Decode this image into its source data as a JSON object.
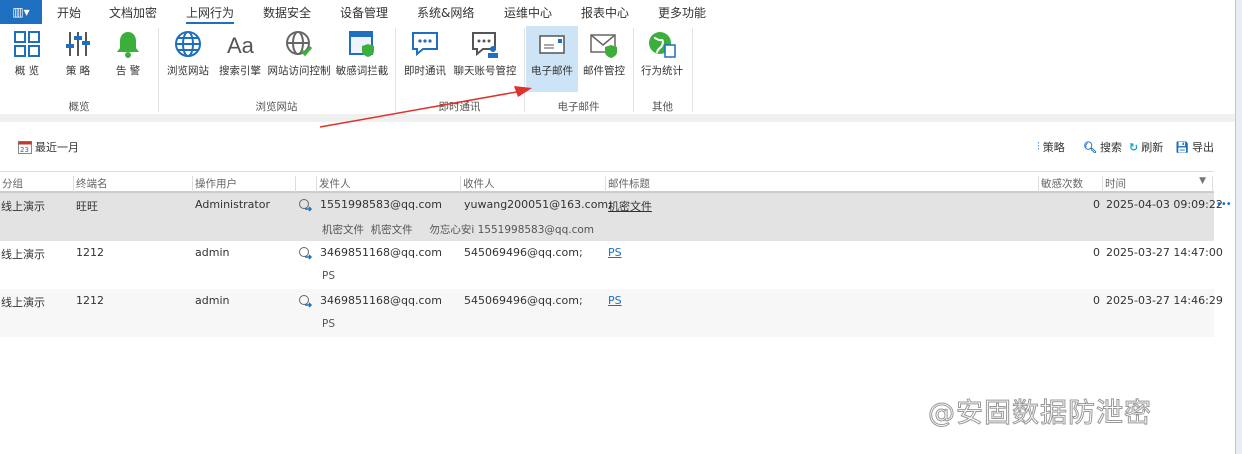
{
  "menubar": {
    "items": [
      "开始",
      "文档加密",
      "上网行为",
      "数据安全",
      "设备管理",
      "系统&网络",
      "运维中心",
      "报表中心",
      "更多功能"
    ],
    "active": "上网行为"
  },
  "ribbon": {
    "buttons": [
      {
        "label": "概 览",
        "icon": "grid-icon"
      },
      {
        "label": "策 略",
        "icon": "sliders-icon"
      },
      {
        "label": "告 警",
        "icon": "bell-icon"
      },
      {
        "label": "浏览网站",
        "icon": "globe-icon"
      },
      {
        "label": "搜索引擎",
        "icon": "font-aa-icon"
      },
      {
        "label": "网站访问控制",
        "icon": "globe-check-icon"
      },
      {
        "label": "敏感词拦截",
        "icon": "webpage-shield-icon"
      },
      {
        "label": "即时通讯",
        "icon": "chat-icon"
      },
      {
        "label": "聊天账号管控",
        "icon": "chat-user-icon"
      },
      {
        "label": "电子邮件",
        "icon": "envelope-icon"
      },
      {
        "label": "邮件管控",
        "icon": "envelope-shield-icon"
      },
      {
        "label": "行为统计",
        "icon": "globe-chart-icon"
      }
    ],
    "groups": [
      "概览",
      "浏览网站",
      "即时通讯",
      "电子邮件",
      "其他"
    ],
    "selected": "电子邮件"
  },
  "toolbar": {
    "date_range": "最近一月",
    "policy": "策略",
    "search": "搜索",
    "refresh": "刷新",
    "export": "导出"
  },
  "table": {
    "headers": [
      "分组",
      "终端名",
      "操作用户",
      "发件人",
      "收件人",
      "邮件标题",
      "敏感次数",
      "时间"
    ],
    "rows": [
      {
        "group": "线上演示",
        "terminal": "旺旺",
        "user": "Administrator",
        "sender": "1551998583@qq.com",
        "receiver": "yuwang200051@163.com;",
        "subject": "机密文件",
        "count": "0",
        "time": "2025-04-03 09:09:22",
        "detail": "机密文件  机密文件     勿忘心安i 1551998583@qq.com",
        "selected": true
      },
      {
        "group": "线上演示",
        "terminal": "1212",
        "user": "admin",
        "sender": "3469851168@qq.com",
        "receiver": "545069496@qq.com;",
        "subject": "PS",
        "count": "0",
        "time": "2025-03-27 14:47:00",
        "detail": "PS"
      },
      {
        "group": "线上演示",
        "terminal": "1212",
        "user": "admin",
        "sender": "3469851168@qq.com",
        "receiver": "545069496@qq.com;",
        "subject": "PS",
        "count": "0",
        "time": "2025-03-27 14:46:29",
        "detail": "PS"
      }
    ],
    "more": "•••"
  },
  "watermark": "@安固数据防泄密",
  "colors": {
    "accent": "#1e6fbf",
    "selected_row": "#e3e3e3",
    "arrow": "#e0322a"
  }
}
